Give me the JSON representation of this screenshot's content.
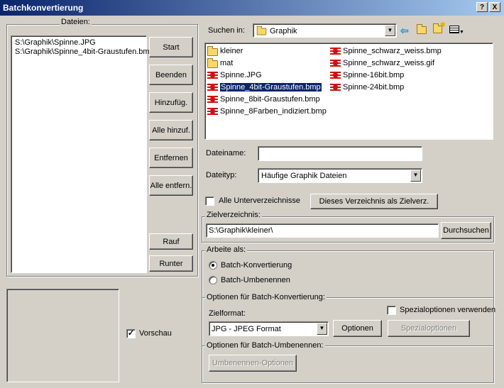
{
  "window": {
    "title": "Batchkonvertierung",
    "help_label": "?",
    "close_label": "X"
  },
  "left": {
    "files_label": "Dateien:",
    "files": [
      "S:\\Graphik\\Spinne.JPG",
      "S:\\Graphik\\Spinne_4bit-Graustufen.bmp"
    ],
    "buttons": {
      "start": "Start",
      "beenden": "Beenden",
      "hinzufueg": "Hinzufüg.",
      "alle_hinzuf": "Alle hinzuf.",
      "entfernen": "Entfernen",
      "alle_entfern": "Alle entfern.",
      "rauf": "Rauf",
      "runter": "Runter"
    },
    "preview_label": "Vorschau",
    "preview_checked": true
  },
  "browser": {
    "search_in_label": "Suchen in:",
    "current_folder": "Graphik",
    "files_col1": [
      {
        "name": "kleiner",
        "type": "folder"
      },
      {
        "name": "mat",
        "type": "folder"
      },
      {
        "name": "Spinne.JPG",
        "type": "image"
      },
      {
        "name": "Spinne_4bit-Graustufen.bmp",
        "type": "image",
        "selected": true
      },
      {
        "name": "Spinne_8bit-Graustufen.bmp",
        "type": "image"
      },
      {
        "name": "Spinne_8Farben_indiziert.bmp",
        "type": "image"
      }
    ],
    "files_col2": [
      {
        "name": "Spinne_schwarz_weiss.bmp",
        "type": "image"
      },
      {
        "name": "Spinne_schwarz_weiss.gif",
        "type": "image"
      },
      {
        "name": "Spinne-16bit.bmp",
        "type": "image"
      },
      {
        "name": "Spinne-24bit.bmp",
        "type": "image"
      }
    ],
    "filename_label": "Dateiname:",
    "filename_value": "",
    "filetype_label": "Dateityp:",
    "filetype_value": "Häufige Graphik Dateien",
    "all_subdirs_label": "Alle Unterverzeichnisse",
    "all_subdirs_checked": false,
    "this_dir_button": "Dieses Verzeichnis als Zielverz."
  },
  "target": {
    "label": "Zielverzeichnis:",
    "value": "S:\\Graphik\\kleiner\\",
    "browse_button": "Durchsuchen"
  },
  "mode": {
    "label": "Arbeite als:",
    "batch_convert": "Batch-Konvertierung",
    "batch_rename": "Batch-Umbenennen",
    "selected": "batch_convert"
  },
  "convert_options": {
    "label": "Optionen für Batch-Konvertierung:",
    "special_options_label": "Spezialoptionen verwenden",
    "special_checked": false,
    "target_format_label": "Zielformat:",
    "target_format_value": "JPG - JPEG Format",
    "options_button": "Optionen",
    "special_options_button": "Spezialoptionen"
  },
  "rename_options": {
    "label": "Optionen für Batch-Umbenennen:",
    "rename_options_button": "Umbenennen-Optionen"
  }
}
